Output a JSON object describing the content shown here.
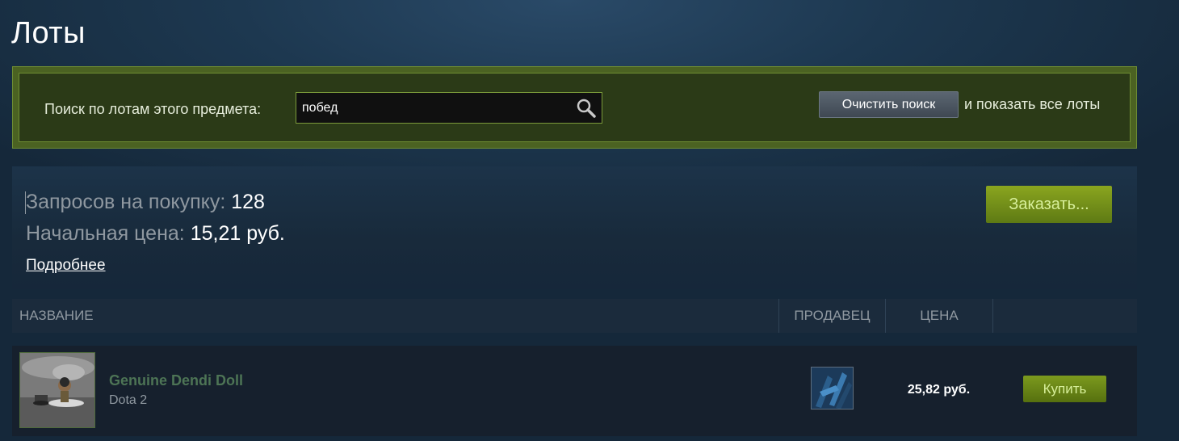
{
  "page": {
    "title": "Лоты"
  },
  "search": {
    "label": "Поиск по лотам этого предмета:",
    "value": "побед",
    "clear_button": "Очистить поиск",
    "show_all_text": "и показать все лоты"
  },
  "orders": {
    "requests_label": "Запросов на покупку:",
    "requests_value": "128",
    "start_price_label": "Начальная цена:",
    "start_price_value": "15,21 руб.",
    "details_link": "Подробнее",
    "order_button": "Заказать..."
  },
  "table": {
    "columns": {
      "name": "НАЗВАНИЕ",
      "seller": "ПРОДАВЕЦ",
      "price": "ЦЕНА"
    }
  },
  "listings": [
    {
      "name": "Genuine Dendi Doll",
      "game": "Dota 2",
      "price": "25,82 руб.",
      "buy_label": "Купить"
    }
  ],
  "colors": {
    "background": "#1d3850",
    "search_panel": "#4b6222",
    "accent_green": "#8aa51f",
    "item_name": "#4d7455"
  }
}
